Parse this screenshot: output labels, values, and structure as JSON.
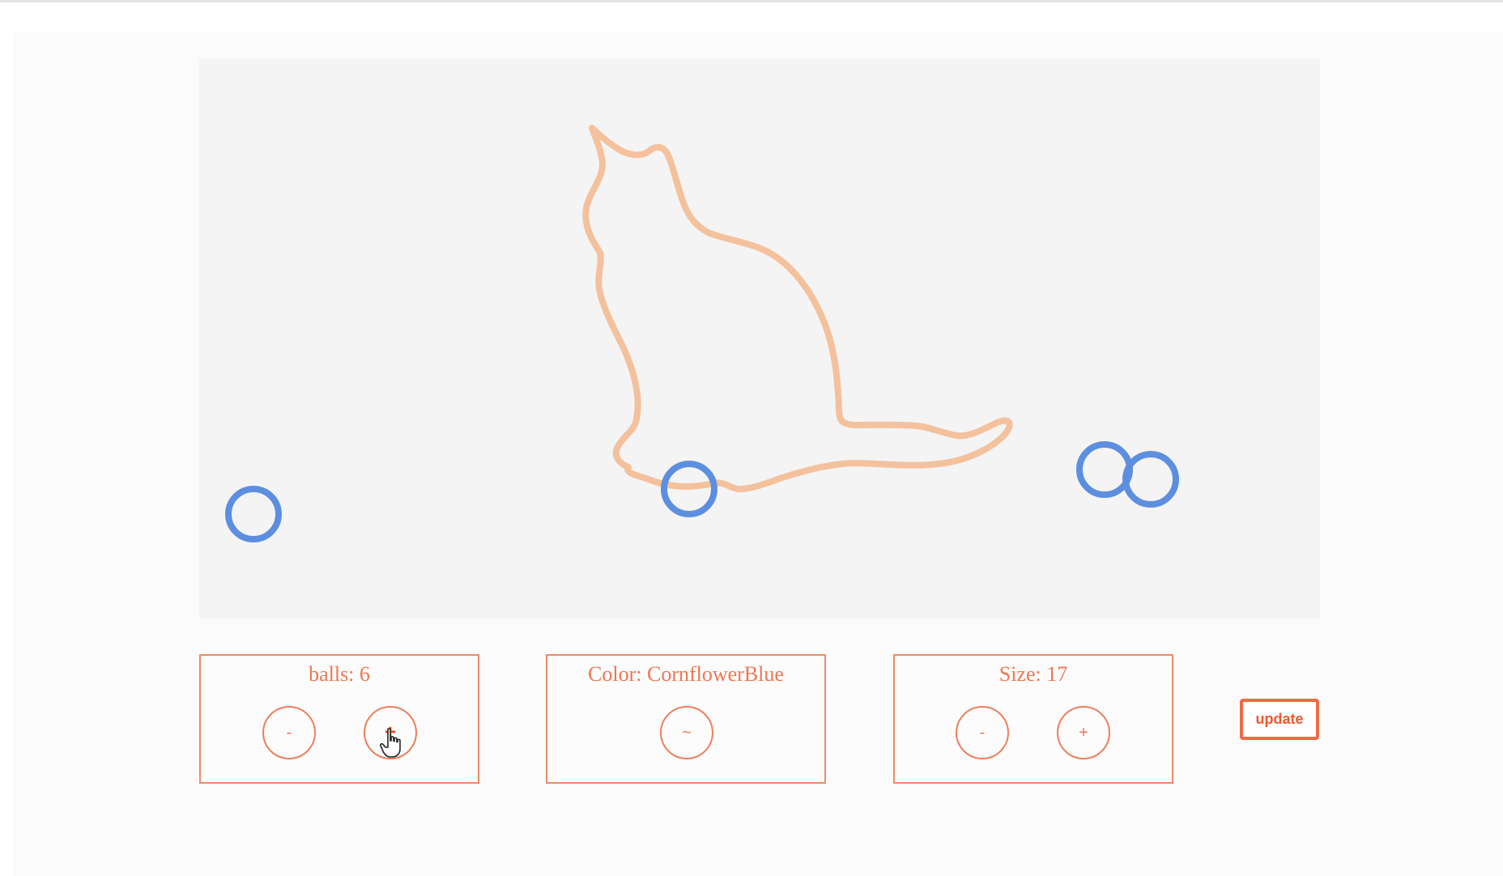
{
  "canvas": {
    "figure": "cat-silhouette-outline",
    "outline_color": "#f4c19d",
    "ball_color": "#5d8fe0"
  },
  "controls": {
    "balls": {
      "label": "balls: 6",
      "minus_label": "-",
      "plus_label": "+"
    },
    "color": {
      "label": "Color: CornflowerBlue",
      "cycle_label": "~"
    },
    "size": {
      "label": "Size: 17",
      "minus_label": "-",
      "plus_label": "+"
    },
    "update_label": "update"
  },
  "colors": {
    "accent": "#ef7f5c",
    "update_border": "#ef6b44",
    "canvas_bg": "#f4f4f4"
  },
  "cursor": {
    "icon": "hand-pointer-icon"
  }
}
